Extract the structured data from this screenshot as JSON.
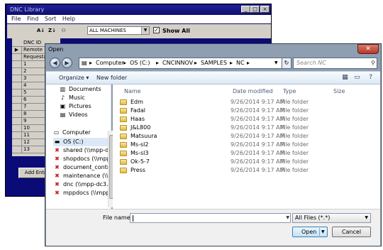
{
  "dnc": {
    "title": "DNC Library",
    "menu": [
      "File",
      "Find",
      "Sort",
      "Help"
    ],
    "toolbar_icons": [
      "A-Z",
      "Z-A",
      "search-users"
    ],
    "machine_filter": "ALL MACHINES",
    "show_all_checked": "✓",
    "show_all_label": "Show All",
    "grid_header": "DNC ID",
    "grid_rows": [
      "Remote R",
      "Requesta",
      "1",
      "2",
      "3",
      "4",
      "5",
      "6",
      "7",
      "8",
      "9",
      "10",
      "11",
      "12",
      "13"
    ],
    "add_entry_label": "Add Entry"
  },
  "dialog": {
    "title": "Open",
    "close_glyph": "✕",
    "address": {
      "segments": [
        "Computer",
        "OS (C:)",
        "CNCINNOV",
        "SAMPLES",
        "NC"
      ],
      "separator": "▸"
    },
    "search_placeholder": "Search NC",
    "commands": {
      "organize": "Organize ▾",
      "new_folder": "New folder"
    },
    "nav": {
      "favorites": [
        {
          "label": "Documents",
          "icon": "documents-icon"
        },
        {
          "label": "Music",
          "icon": "music-icon"
        },
        {
          "label": "Pictures",
          "icon": "pictures-icon"
        },
        {
          "label": "Videos",
          "icon": "videos-icon"
        }
      ],
      "computer_label": "Computer",
      "drives": [
        {
          "label": "OS (C:)",
          "icon": "drive-icon"
        },
        {
          "label": "shared (\\\\mpp-d",
          "icon": "network-drive-icon"
        },
        {
          "label": "shopdocs (\\\\mpp",
          "icon": "network-drive-icon"
        },
        {
          "label": "document_contr",
          "icon": "network-drive-icon"
        },
        {
          "label": "maintenance (\\\\",
          "icon": "network-drive-icon"
        },
        {
          "label": "dnc (\\\\mpp-dc3.",
          "icon": "network-drive-icon"
        },
        {
          "label": "mppdocs (\\\\mpp",
          "icon": "network-drive-icon"
        }
      ]
    },
    "columns": [
      "Name",
      "Date modified",
      "Type",
      "Size"
    ],
    "files": [
      {
        "name": "Edm",
        "date": "9/26/2014 9:17 AM",
        "type": "File folder"
      },
      {
        "name": "Fadal",
        "date": "9/26/2014 9:17 AM",
        "type": "File folder"
      },
      {
        "name": "Haas",
        "date": "9/26/2014 9:17 AM",
        "type": "File folder"
      },
      {
        "name": "J&L800",
        "date": "9/26/2014 9:17 AM",
        "type": "File folder"
      },
      {
        "name": "Matsuura",
        "date": "9/26/2014 9:17 AM",
        "type": "File folder"
      },
      {
        "name": "Ms-sl2",
        "date": "9/26/2014 9:17 AM",
        "type": "File folder"
      },
      {
        "name": "Ms-sl3",
        "date": "9/26/2014 9:17 AM",
        "type": "File folder"
      },
      {
        "name": "Ok-5-7",
        "date": "9/26/2014 9:17 AM",
        "type": "File folder"
      },
      {
        "name": "Press",
        "date": "9/26/2014 9:17 AM",
        "type": "File folder"
      }
    ],
    "file_name_label": "File name:",
    "file_name_value": "",
    "filter_value": "All Files (*.*)",
    "open_label": "Open",
    "cancel_label": "Cancel"
  }
}
